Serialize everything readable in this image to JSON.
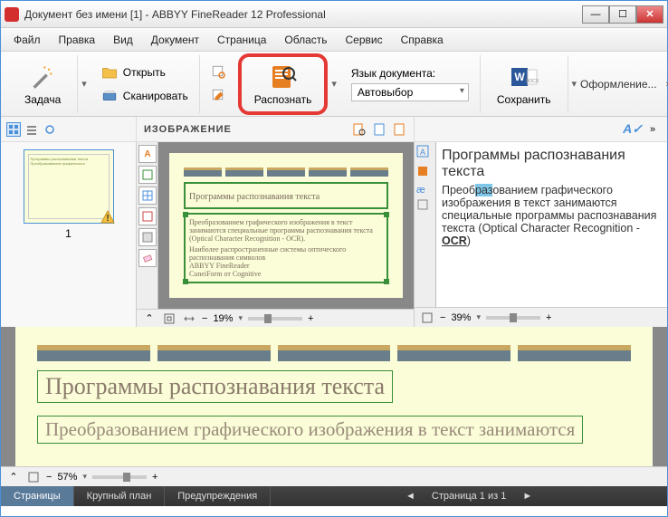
{
  "window": {
    "title": "Документ без имени [1] - ABBYY FineReader 12 Professional"
  },
  "menu": [
    "Файл",
    "Правка",
    "Вид",
    "Документ",
    "Страница",
    "Область",
    "Сервис",
    "Справка"
  ],
  "toolbar": {
    "task": "Задача",
    "open": "Открыть",
    "scan": "Сканировать",
    "recognize": "Распознать",
    "lang_label": "Язык документа:",
    "lang_value": "Автовыбор",
    "save": "Сохранить",
    "format": "Оформление..."
  },
  "subheader": {
    "label": "ИЗОБРАЖЕНИЕ"
  },
  "thumbs": {
    "page_number": "1"
  },
  "imgpane": {
    "title_text": "Программы распознавания текста",
    "body_text": "Преобразованием графического изображения в текст занимаются специальные программы распознавания текста (Optical Character Recognition - OCR).",
    "extra_text": "Наиболее распространенные системы оптического распознавания символов",
    "list1": "ABBYY FineReader",
    "list2": "CuneiForm от Cognitive",
    "zoom": "19%"
  },
  "rightpane": {
    "title": "Программы распознавания текста",
    "body_pre": "Преоб",
    "body_hl": "раз",
    "body_post": "ованием графического изображения в текст занимаются специальные программы распознавания текста (Optical Character Recognition -",
    "body_ocr": "OCR",
    "body_close": ")",
    "zoom": "39%"
  },
  "bigpane": {
    "title": "Программы распознавания текста",
    "body": "Преобразованием графического изображения в текст занимаются",
    "zoom": "57%"
  },
  "status": {
    "tab_pages": "Страницы",
    "tab_zoom": "Крупный план",
    "tab_warn": "Предупреждения",
    "page_info": "Страница 1 из 1"
  }
}
